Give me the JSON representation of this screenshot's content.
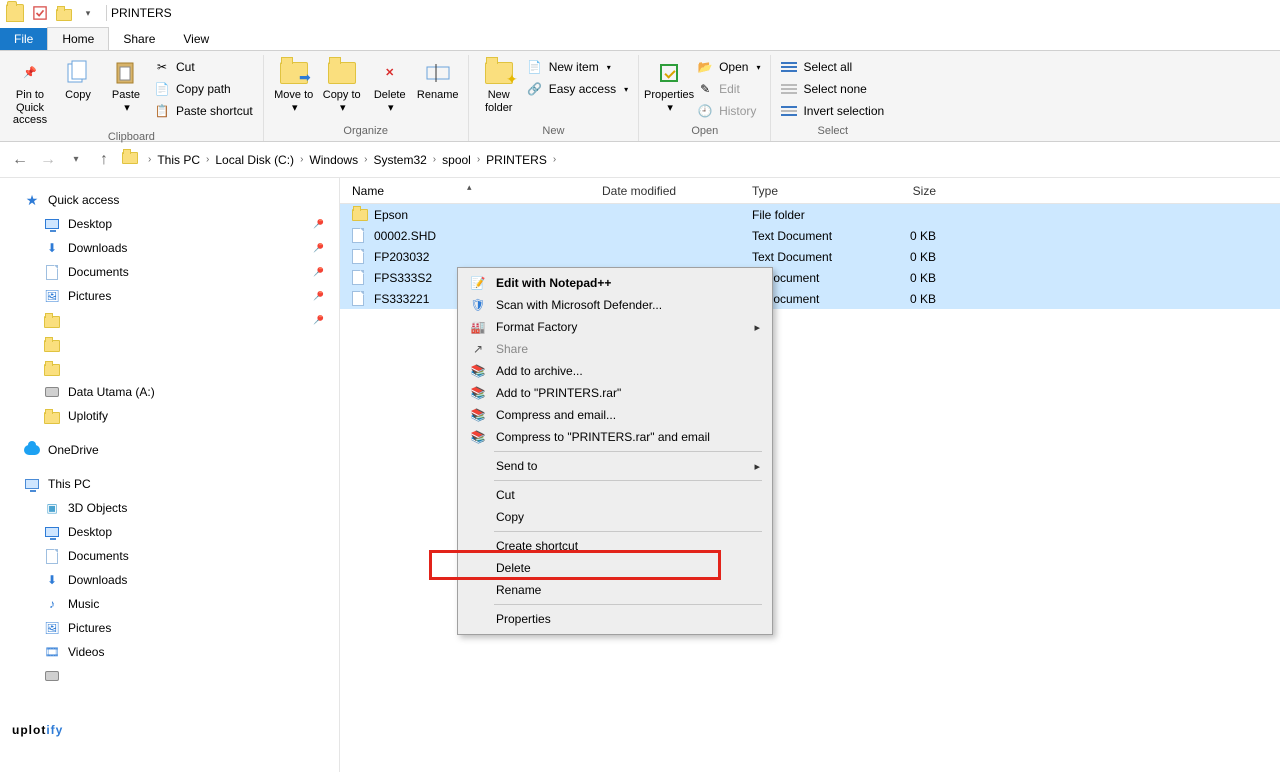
{
  "titlebar": {
    "title": "PRINTERS"
  },
  "tabs": {
    "file": "File",
    "home": "Home",
    "share": "Share",
    "view": "View"
  },
  "ribbon": {
    "pin": "Pin to Quick access",
    "copy": "Copy",
    "paste": "Paste",
    "cut": "Cut",
    "copy_path": "Copy path",
    "paste_shortcut": "Paste shortcut",
    "clipboard": "Clipboard",
    "move_to": "Move to",
    "copy_to": "Copy to",
    "delete": "Delete",
    "rename": "Rename",
    "organize": "Organize",
    "new_folder": "New folder",
    "new_item": "New item",
    "easy_access": "Easy access",
    "new": "New",
    "properties": "Properties",
    "open": "Open",
    "edit": "Edit",
    "history": "History",
    "open_group": "Open",
    "select_all": "Select all",
    "select_none": "Select none",
    "invert": "Invert selection",
    "select": "Select"
  },
  "breadcrumbs": [
    "This PC",
    "Local Disk (C:)",
    "Windows",
    "System32",
    "spool",
    "PRINTERS"
  ],
  "columns": {
    "name": "Name",
    "date": "Date modified",
    "type": "Type",
    "size": "Size"
  },
  "rows": [
    {
      "name": "Epson",
      "type": "File folder",
      "size": "",
      "kind": "folder"
    },
    {
      "name": "00002.SHD",
      "type": "Text Document",
      "size": "0 KB",
      "kind": "file"
    },
    {
      "name": "FP203032",
      "type": "Text Document",
      "size": "0 KB",
      "kind": "file"
    },
    {
      "name": "FPS333S2",
      "type": "xt Document",
      "size": "0 KB",
      "kind": "file"
    },
    {
      "name": "FS333221",
      "type": "xt Document",
      "size": "0 KB",
      "kind": "file"
    }
  ],
  "sidebar": {
    "quick_access": "Quick access",
    "desktop": "Desktop",
    "downloads": "Downloads",
    "documents": "Documents",
    "pictures": "Pictures",
    "data_utama": "Data Utama (A:)",
    "uplotify": "Uplotify",
    "onedrive": "OneDrive",
    "this_pc": "This PC",
    "objects_3d": "3D Objects",
    "music": "Music",
    "videos": "Videos"
  },
  "context_menu": {
    "edit_npp": "Edit with Notepad++",
    "scan": "Scan with Microsoft Defender...",
    "format_factory": "Format Factory",
    "share": "Share",
    "add_archive": "Add to archive...",
    "add_printers_rar": "Add to \"PRINTERS.rar\"",
    "compress_email": "Compress and email...",
    "compress_printers_email": "Compress to \"PRINTERS.rar\" and email",
    "send_to": "Send to",
    "cut": "Cut",
    "copy": "Copy",
    "create_shortcut": "Create shortcut",
    "delete": "Delete",
    "rename": "Rename",
    "properties": "Properties"
  },
  "watermark": {
    "a": "uplot",
    "b": "i",
    "c": "fy"
  }
}
